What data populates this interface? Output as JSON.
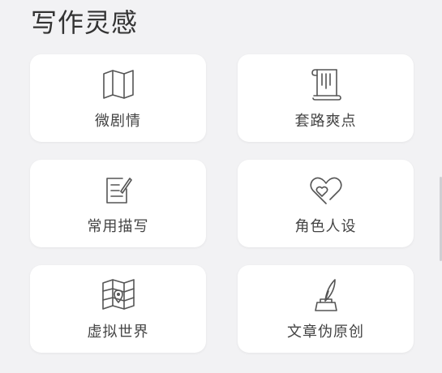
{
  "section": {
    "title": "写作灵感"
  },
  "cards": [
    {
      "label": "微剧情",
      "icon": "map-icon"
    },
    {
      "label": "套路爽点",
      "icon": "scroll-icon"
    },
    {
      "label": "常用描写",
      "icon": "notepad-pen-icon"
    },
    {
      "label": "角色人设",
      "icon": "hearts-icon"
    },
    {
      "label": "虚拟世界",
      "icon": "world-map-icon"
    },
    {
      "label": "文章伪原创",
      "icon": "quill-ink-icon"
    }
  ],
  "colors": {
    "background": "#f2f2f4",
    "card": "#ffffff",
    "text": "#444444",
    "icon_stroke": "#555555"
  }
}
